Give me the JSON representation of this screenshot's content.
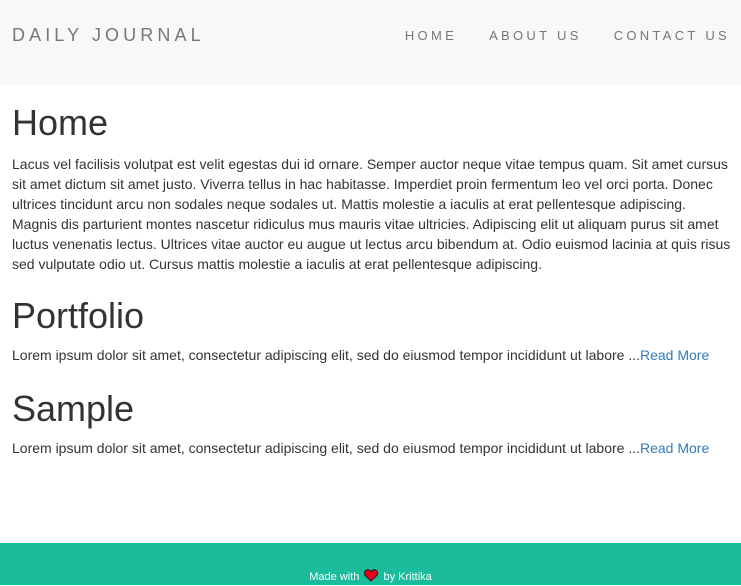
{
  "navbar": {
    "brand": "DAILY JOURNAL",
    "links": [
      {
        "label": "HOME"
      },
      {
        "label": "ABOUT US"
      },
      {
        "label": "CONTACT US"
      }
    ]
  },
  "sections": {
    "home": {
      "title": "Home",
      "body": "Lacus vel facilisis volutpat est velit egestas dui id ornare. Semper auctor neque vitae tempus quam. Sit amet cursus sit amet dictum sit amet justo. Viverra tellus in hac habitasse. Imperdiet proin fermentum leo vel orci porta. Donec ultrices tincidunt arcu non sodales neque sodales ut. Mattis molestie a iaculis at erat pellentesque adipiscing. Magnis dis parturient montes nascetur ridiculus mus mauris vitae ultricies. Adipiscing elit ut aliquam purus sit amet luctus venenatis lectus. Ultrices vitae auctor eu augue ut lectus arcu bibendum at. Odio euismod lacinia at quis risus sed vulputate odio ut. Cursus mattis molestie a iaculis at erat pellentesque adipiscing."
    },
    "portfolio": {
      "title": "Portfolio",
      "excerpt": "Lorem ipsum dolor sit amet, consectetur adipiscing elit, sed do eiusmod tempor incididunt ut labore ...",
      "read_more": "Read More"
    },
    "sample": {
      "title": "Sample",
      "excerpt": "Lorem ipsum dolor sit amet, consectetur adipiscing elit, sed do eiusmod tempor incididunt ut labore ...",
      "read_more": "Read More"
    }
  },
  "footer": {
    "made_with": "Made with",
    "icon": "heart-icon",
    "by": "by Krittika"
  },
  "colors": {
    "navbar_bg": "#f8f8f8",
    "footer_bg": "#1abc9c",
    "link": "#337ab7",
    "heart": "#e0001b"
  }
}
